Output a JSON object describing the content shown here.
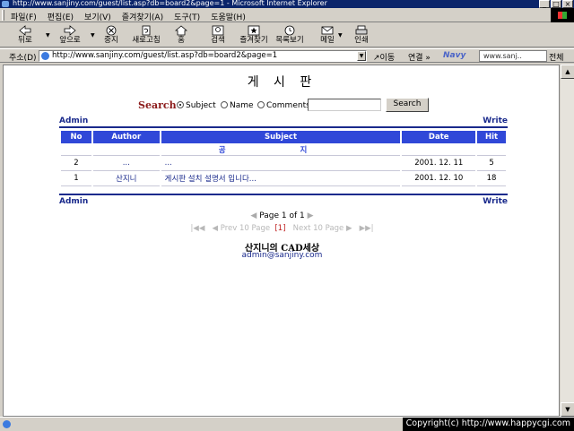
{
  "window": {
    "title": "http://www.sanjiny.com/guest/list.asp?db=board2&page=1 - Microsoft Internet Explorer",
    "minimize": "_",
    "maximize": "□",
    "close": "×"
  },
  "menu": [
    "파일(F)",
    "편집(E)",
    "보기(V)",
    "즐겨찾기(A)",
    "도구(T)",
    "도움말(H)"
  ],
  "toolbar": {
    "back": "뒤로",
    "forward": "앞으로",
    "stop": "중지",
    "refresh": "새로고침",
    "home": "홈",
    "search": "검색",
    "favorites": "즐겨찾기",
    "history": "목록보기",
    "mail": "메일",
    "print": "인쇄"
  },
  "addressbar": {
    "label": "주소(D)",
    "url": "http://www.sanjiny.com/guest/list.asp?db=board2&page=1",
    "go": "이동",
    "links": "연결 »",
    "navy": "Navy",
    "navy_search": "www.sanj..",
    "all": "전체"
  },
  "page": {
    "title": "게 시 판",
    "search_label": "Search",
    "opt_subject": "Subject",
    "opt_name": "Name",
    "opt_comments": "Comments",
    "search_button": "Search",
    "admin": "Admin",
    "write": "Write",
    "columns": [
      "No",
      "Author",
      "Subject",
      "Date",
      "Hit"
    ],
    "notice": "공 지",
    "rows": [
      {
        "no": "2",
        "author": "...",
        "subject": "...",
        "date": "2001. 12. 11",
        "hit": "5"
      },
      {
        "no": "1",
        "author": "산지니",
        "subject": "게시판 설치 설명서 입니다...",
        "date": "2001. 12. 10",
        "hit": "18"
      }
    ],
    "page_word": "Page",
    "page_current": "1",
    "page_of": "of",
    "page_total": "1",
    "prev10": "Prev 10 Page",
    "cur_marker": "[1]",
    "next10": "Next 10 Page",
    "footer_name": "산지니의 CAD세상",
    "footer_email": "admin@sanjiny.com"
  },
  "status": {
    "copyright": "Copyright(c) http://www.happycgi.com"
  }
}
